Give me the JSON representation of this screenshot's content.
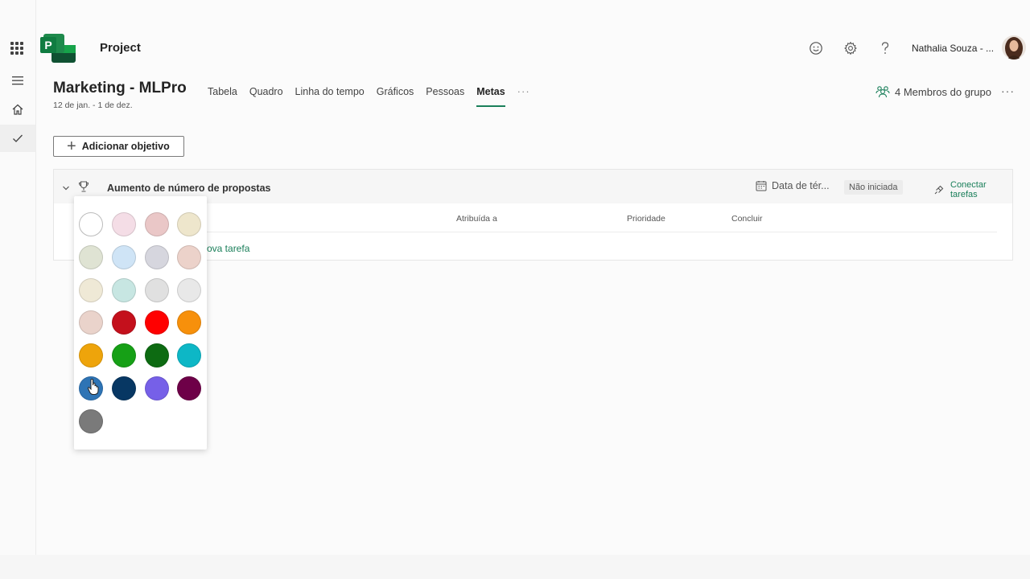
{
  "app": {
    "title": "Project"
  },
  "header": {
    "user_name": "Nathalia Souza - ...",
    "icons": [
      "smiley-icon",
      "gear-icon",
      "help-icon"
    ]
  },
  "rail": {
    "icons": [
      "waffle-icon",
      "hamburger-icon",
      "home-icon",
      "check-icon"
    ]
  },
  "project": {
    "name": "Marketing - MLPro",
    "dates": "12 de jan. - 1 de dez.",
    "tabs": [
      {
        "label": "Tabela"
      },
      {
        "label": "Quadro"
      },
      {
        "label": "Linha do tempo"
      },
      {
        "label": "Gráficos"
      },
      {
        "label": "Pessoas"
      },
      {
        "label": "Metas",
        "active": true
      }
    ],
    "tabs_more": "···",
    "members_label": "4 Membros do grupo",
    "more": "···"
  },
  "toolbar": {
    "add_objective": "Adicionar objetivo"
  },
  "objective": {
    "title": "Aumento de número de propostas",
    "date_label": "Data de tér...",
    "status": "Não iniciada",
    "connect_label": "Conectar tarefas",
    "columns": {
      "assigned": "Atribuída a",
      "priority": "Prioridade",
      "complete": "Concluir"
    },
    "new_task": "ova tarefa"
  },
  "color_picker": {
    "swatches": [
      "#ffffff",
      "#f4dde6",
      "#eac7c7",
      "#eee6cc",
      "#dfe3d3",
      "#cfe4f6",
      "#d6d6de",
      "#ecd2ca",
      "#efe9d6",
      "#c7e6e2",
      "#e0e0e0",
      "#e8e8e8",
      "#ead3cb",
      "#c4101c",
      "#ff0000",
      "#f7900b",
      "#eea40b",
      "#16a016",
      "#0d6b12",
      "#0db7c6",
      "#2e74b5",
      "#073763",
      "#7660e8",
      "#6e0048",
      "#7a7a7a"
    ],
    "selected_index": 0
  },
  "colors": {
    "accent": "#1a7f5a"
  }
}
